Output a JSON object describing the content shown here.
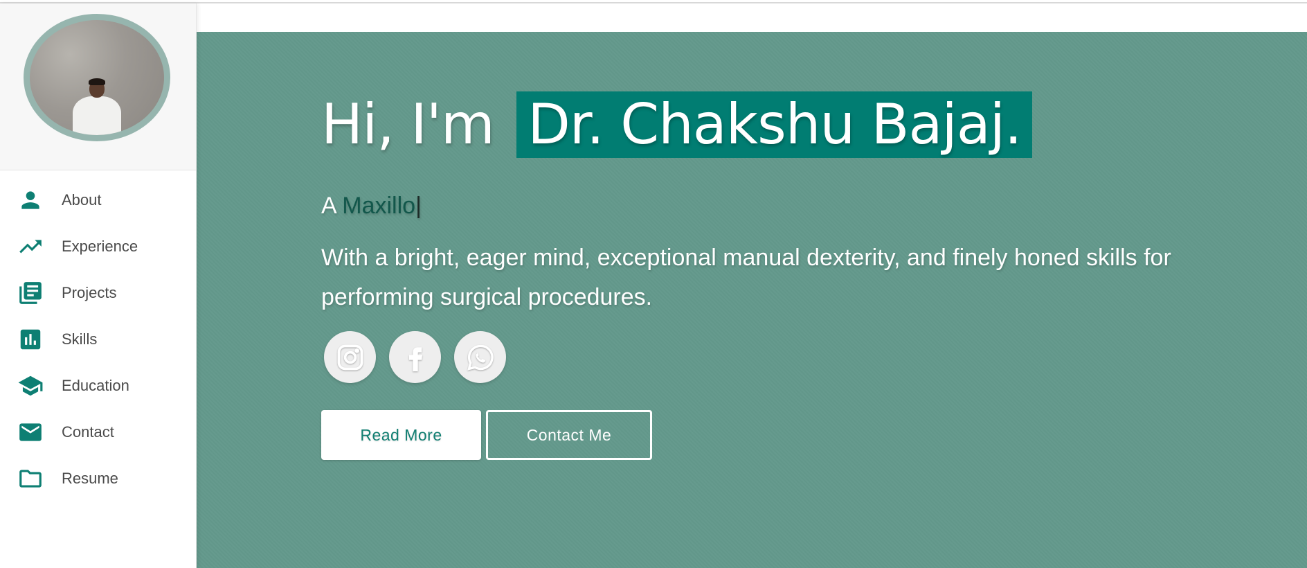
{
  "sidebar": {
    "nav": [
      {
        "label": "About",
        "icon": "person-icon"
      },
      {
        "label": "Experience",
        "icon": "trending-up-icon"
      },
      {
        "label": "Projects",
        "icon": "library-books-icon"
      },
      {
        "label": "Skills",
        "icon": "bar-chart-icon"
      },
      {
        "label": "Education",
        "icon": "graduation-cap-icon"
      },
      {
        "label": "Contact",
        "icon": "mail-icon"
      },
      {
        "label": "Resume",
        "icon": "folder-icon"
      }
    ]
  },
  "hero": {
    "greeting": "Hi, I'm",
    "name": "Dr. Chakshu Bajaj.",
    "typed_prefix": "A",
    "typed_word": "Maxillo",
    "caret": "|",
    "description": "With a bright, eager mind, exceptional manual dexterity, and finely honed skills for performing surgical procedures.",
    "social": [
      {
        "name": "instagram-icon"
      },
      {
        "name": "facebook-icon"
      },
      {
        "name": "whatsapp-icon"
      }
    ],
    "read_more_label": "Read More",
    "contact_me_label": "Contact Me"
  },
  "colors": {
    "accent": "#0e7f73",
    "hero_bg": "#64998c",
    "name_highlight": "#017d72",
    "typed_word": "#12574b"
  }
}
